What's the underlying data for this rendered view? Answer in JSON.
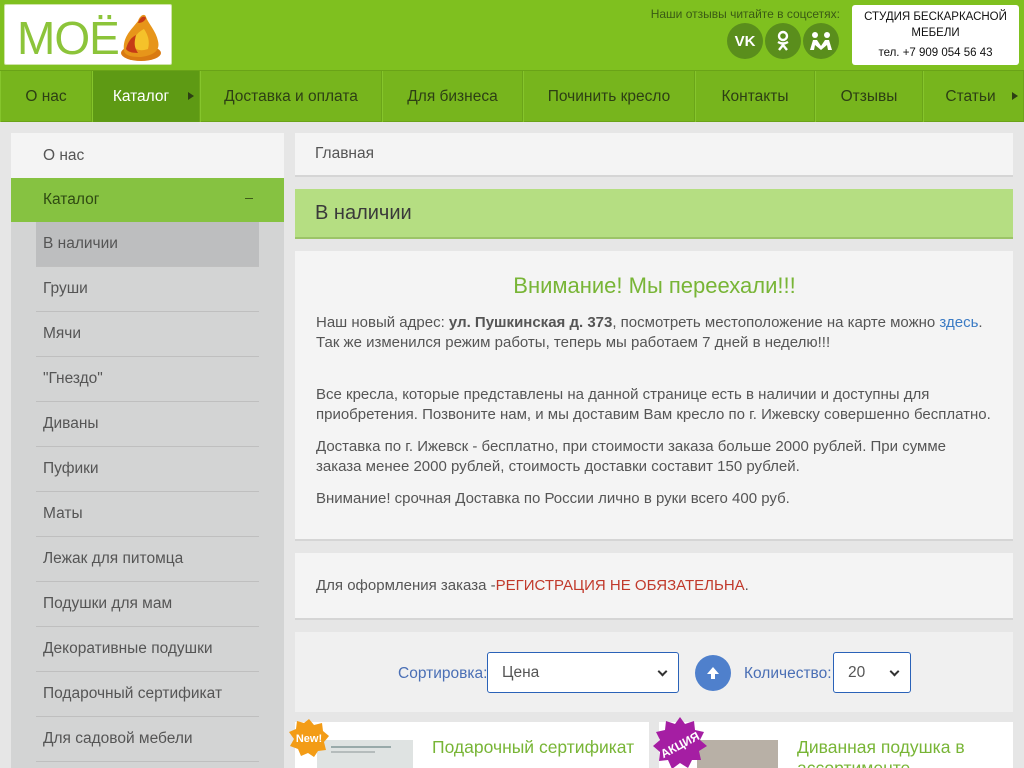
{
  "header": {
    "logo_text": "МОЁ",
    "reviews_text": "Наши отзывы читайте в соцсетях:",
    "social": [
      {
        "name": "vk-icon",
        "glyph": "VK"
      },
      {
        "name": "odnoklassniki-icon",
        "glyph": "ok"
      },
      {
        "name": "moi-krug-icon",
        "glyph": "мк"
      }
    ],
    "studio_line1": "СТУДИЯ БЕСКАРКАСНОЙ",
    "studio_line2": "МЕБЕЛИ",
    "phone": "тел. +7 909 054 56 43"
  },
  "nav": {
    "items": [
      {
        "label": "О нас"
      },
      {
        "label": "Каталог"
      },
      {
        "label": "Доставка и оплата"
      },
      {
        "label": "Для бизнеса"
      },
      {
        "label": "Починить кресло"
      },
      {
        "label": "Контакты"
      },
      {
        "label": "Отзывы"
      },
      {
        "label": "Статьи"
      }
    ]
  },
  "sidebar": {
    "top": "О нас",
    "catalog": "Каталог",
    "items": [
      {
        "label": "В наличии"
      },
      {
        "label": "Груши"
      },
      {
        "label": "Мячи"
      },
      {
        "label": "\"Гнездо\""
      },
      {
        "label": "Диваны"
      },
      {
        "label": "Пуфики"
      },
      {
        "label": "Маты"
      },
      {
        "label": "Лежак для питомца"
      },
      {
        "label": "Подушки для мам"
      },
      {
        "label": "Декоративные подушки"
      },
      {
        "label": "Подарочный сертификат"
      },
      {
        "label": "Для садовой мебели"
      }
    ]
  },
  "breadcrumb": "Главная",
  "page_title": "В наличии",
  "content": {
    "attention": "Внимание! Мы переехали!!!",
    "addr_prefix": "Наш новый адрес: ",
    "addr_bold": "ул. Пушкинская д. 373",
    "addr_middle": ", посмотреть местоположение на карте можно ",
    "addr_link": "здесь",
    "addr_end": ".",
    "schedule": "Так же изменился режим работы, теперь мы работаем 7 дней в неделю!!!",
    "p2": "Все кресла, которые представлены на данной странице есть в наличии и доступны для приобретения. Позвоните нам, и мы доставим Вам кресло по г. Ижевску совершенно бесплатно.",
    "p3": "Доставка по г. Ижевск - бесплатно, при стоимости заказа больше 2000 рублей. При сумме заказа менее 2000 рублей, стоимость доставки составит 150 рублей.",
    "p4": "Внимание! срочная Доставка по России лично в руки всего 400 руб."
  },
  "order": {
    "prefix": "Для оформления заказа - ",
    "red": "РЕГИСТРАЦИЯ НЕ ОБЯЗАТЕЛЬНА",
    "suffix": "."
  },
  "sorting": {
    "sort_label": "Сортировка:",
    "sort_value": "Цена",
    "qty_label": "Количество:",
    "qty_value": "20"
  },
  "products": [
    {
      "badge": "New!",
      "title": "Подарочный сертификат"
    },
    {
      "badge": "АКЦИЯ",
      "title": "Диванная подушка в ассортименте"
    }
  ],
  "colors": {
    "brand_green": "#7fc01f",
    "accent_green": "#78b536",
    "link_blue": "#3b7bc4",
    "alert_red": "#c1392b"
  }
}
